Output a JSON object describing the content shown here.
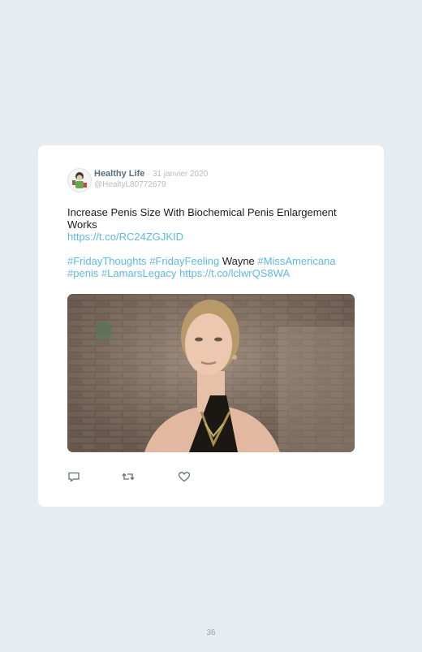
{
  "tweet": {
    "author_name": "Healthy Life",
    "separator": "·",
    "date": "31 janvier 2020",
    "handle": "@HealtyL80772679",
    "line1": "Increase Penis Size With Biochemical Penis Enlargement",
    "line2": "Works",
    "link1": "https://t.co/RC24ZGJKID",
    "tag_friday_thoughts": "#FridayThoughts",
    "tag_friday_feeling": "#FridayFeeling",
    "plain_word": "Wayne",
    "tag_miss_americana": "#MissAmericana",
    "tag_penis": "#penis",
    "tag_lamars_legacy": "#LamarsLegacy",
    "link2": "https://t.co/lclwrQS8WA"
  },
  "actions": {
    "reply_icon": "reply-icon",
    "retweet_icon": "retweet-icon",
    "like_icon": "heart-icon"
  },
  "colors": {
    "background": "#e6ecf0",
    "card": "#ffffff",
    "link": "#5fb8e6",
    "name": "#556f82",
    "muted": "#b4bcc3"
  },
  "page_number": "36"
}
